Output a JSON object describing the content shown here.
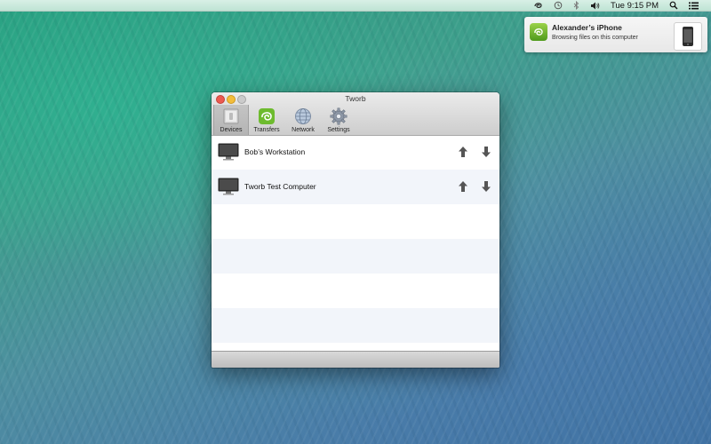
{
  "menubar": {
    "clock": "Tue 9:15 PM",
    "icons": [
      "tworb-menu-icon",
      "time-machine-icon",
      "bluetooth-icon",
      "volume-icon",
      "spotlight-icon",
      "notification-center-icon"
    ]
  },
  "notification": {
    "title": "Alexander’s iPhone",
    "body": "Browsing files on this computer",
    "app_icon": "tworb-icon",
    "device_icon": "iphone-icon"
  },
  "window": {
    "title": "Tworb",
    "toolbar": [
      {
        "label": "Devices",
        "icon": "devices-icon",
        "selected": true
      },
      {
        "label": "Transfers",
        "icon": "transfers-icon",
        "selected": false
      },
      {
        "label": "Network",
        "icon": "network-icon",
        "selected": false
      },
      {
        "label": "Settings",
        "icon": "settings-icon",
        "selected": false
      }
    ],
    "devices": [
      {
        "name": "Bob’s Workstation",
        "icon": "monitor-icon"
      },
      {
        "name": "Tworb Test Computer",
        "icon": "monitor-icon"
      }
    ]
  },
  "colors": {
    "close": "#ec5a50",
    "minimize": "#f3bd3b",
    "zoom": "#cbcbcb",
    "row_alt": "#f2f5fa",
    "arrow": "#555555"
  }
}
